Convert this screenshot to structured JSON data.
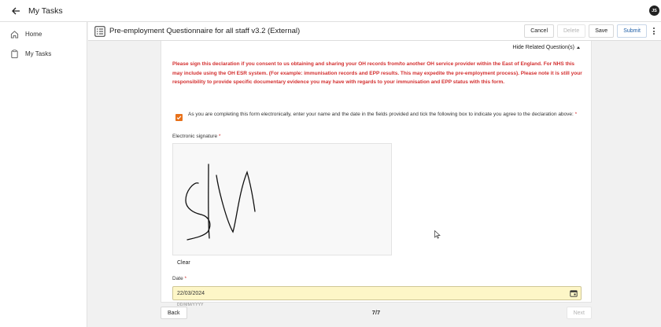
{
  "topbar": {
    "title": "My Tasks",
    "avatar": "JS"
  },
  "sidebar": {
    "items": [
      {
        "label": "Home",
        "icon": "home-icon"
      },
      {
        "label": "My Tasks",
        "icon": "clipboard-icon"
      }
    ]
  },
  "header": {
    "title": "Pre-employment Questionnaire for all staff v3.2 (External)",
    "actions": {
      "cancel": "Cancel",
      "delete": "Delete",
      "save": "Save",
      "submit": "Submit"
    }
  },
  "form": {
    "hide_related": "Hide Related Question(s)",
    "declaration": "Please sign this declaration if you consent to us obtaining and sharing your OH records from/to another OH service provider within the East of England. For NHS this may include using the OH ESR system. (For example: immunisation records and EPP results. This may expedite the pre-employment process). Please note it is still your responsibility to provide specific documentary evidence you may have with regards to your immunisation and EPP status with this form.",
    "consent_text": "As you are completing this form electronically, enter your name and the date in the fields provided and tick the following box to indicate you agree to the declaration above:",
    "consent_checked": true,
    "signature_label": "Electronic signature",
    "clear_label": "Clear",
    "date_label": "Date",
    "date_value": "22/03/2024",
    "date_hint": "DD/MM/YYYY",
    "required_marker": "*"
  },
  "footer": {
    "back": "Back",
    "page": "7/7",
    "next": "Next"
  },
  "colors": {
    "accent": "#e8711a",
    "error": "#d32f2f",
    "date_bg": "#fdf6c7",
    "primary": "#1f5fa8"
  }
}
